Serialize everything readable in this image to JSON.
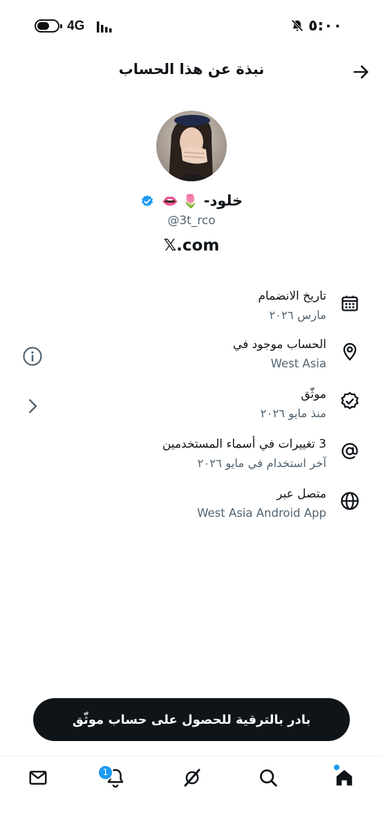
{
  "status_bar": {
    "network": "4G",
    "time": "٥:٠٠",
    "battery_level": 0.6
  },
  "header": {
    "title": "نبذة عن هذا الحساب"
  },
  "profile": {
    "name": "خلود-",
    "emojis": "🌷 👄",
    "handle": "@3t_rco",
    "domain": "𝕏.com"
  },
  "info_rows": [
    {
      "icon": "calendar-icon",
      "title": "تاريخ الانضمام",
      "subtitle": "مارس ٢٠٢٦"
    },
    {
      "icon": "location-pin-icon",
      "title": "الحساب موجود في",
      "subtitle": "West Asia",
      "side_icon": "info-icon"
    },
    {
      "icon": "verified-badge-icon",
      "title": "موثّق",
      "subtitle": "منذ مايو ٢٠٢٦",
      "side_icon": "chevron-right-icon"
    },
    {
      "icon": "at-sign-icon",
      "title": "3 تغييرات في أسماء المستخدمين",
      "subtitle": "آخر استخدام في مايو ٢٠٢٦"
    },
    {
      "icon": "globe-icon",
      "title": "متصل عبر",
      "subtitle": "West Asia Android App"
    }
  ],
  "upgrade": {
    "label": "بادر بالترقية للحصول على حساب موثّق"
  },
  "bottom_nav": {
    "notification_count": "1",
    "items": [
      "mail-icon",
      "bell-icon",
      "grok-icon",
      "search-icon",
      "home-icon"
    ]
  },
  "colors": {
    "accent": "#1d9bf0",
    "text_primary": "#0f1419",
    "text_secondary": "#536471",
    "button_bg": "#0f1419"
  }
}
